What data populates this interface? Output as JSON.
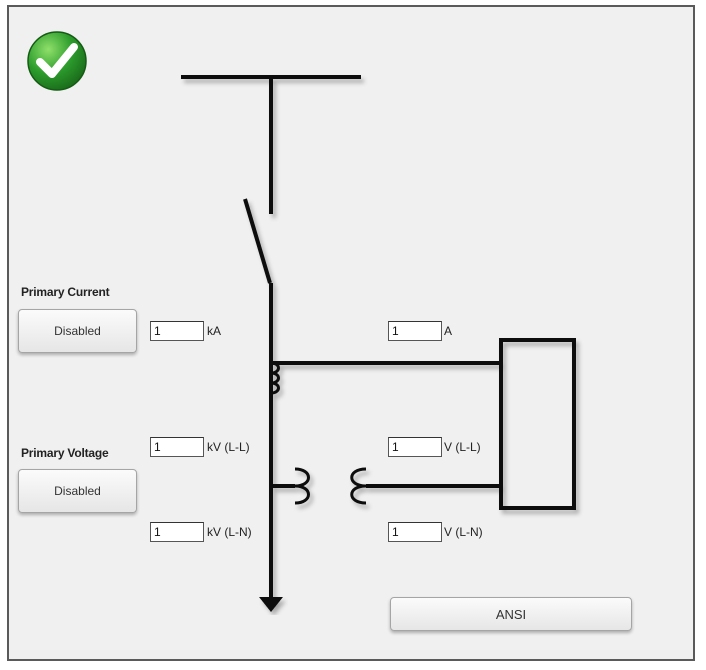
{
  "status": {
    "icon": "check-circle-icon",
    "color": "#2c9c2c"
  },
  "primary_current": {
    "label": "Primary Current",
    "button_label": "Disabled",
    "primary_value": "1",
    "primary_unit": "kA",
    "secondary_value": "1",
    "secondary_unit": "A"
  },
  "primary_voltage": {
    "label": "Primary Voltage",
    "button_label": "Disabled",
    "primary_ll_value": "1",
    "primary_ll_unit": "kV (L-L)",
    "primary_ln_value": "1",
    "primary_ln_unit": "kV (L-N)",
    "secondary_ll_value": "1",
    "secondary_ll_unit": "V (L-L)",
    "secondary_ln_value": "1",
    "secondary_ln_unit": "V (L-N)"
  },
  "standard_button": {
    "label": "ANSI"
  }
}
